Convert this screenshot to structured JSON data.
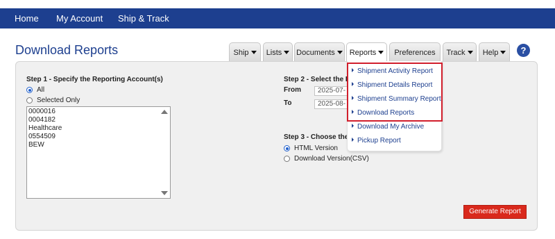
{
  "topnav": {
    "items": [
      {
        "label": "Home"
      },
      {
        "label": "My Account"
      },
      {
        "label": "Ship & Track"
      }
    ]
  },
  "page": {
    "title": "Download Reports"
  },
  "tabs": [
    {
      "label": "Ship",
      "has_caret": true
    },
    {
      "label": "Lists",
      "has_caret": true
    },
    {
      "label": "Documents",
      "has_caret": true
    },
    {
      "label": "Reports",
      "has_caret": true,
      "active": true
    },
    {
      "label": "Preferences",
      "has_caret": false
    },
    {
      "label": "Track",
      "has_caret": true
    },
    {
      "label": "Help",
      "has_caret": true
    }
  ],
  "help_icon": {
    "glyph": "?"
  },
  "step1": {
    "heading": "Step 1 - Specify the Reporting Account(s)",
    "radio_all": "All",
    "radio_selected": "Selected Only",
    "selected_option": "All",
    "accounts": [
      "0000016",
      "0004182",
      "Healthcare",
      "0554509",
      "BEW"
    ]
  },
  "step2": {
    "heading": "Step 2 - Select the D",
    "from_label": "From",
    "from_value": "2025-07-",
    "to_label": "To",
    "to_value": "2025-08-"
  },
  "step3": {
    "heading": "Step 3 - Choose the",
    "option_html": "HTML Version",
    "option_csv": "Download Version(CSV)",
    "selected_option": "HTML Version"
  },
  "reports_menu": {
    "items": [
      {
        "label": "Shipment Activity Report"
      },
      {
        "label": "Shipment Details Report"
      },
      {
        "label": "Shipment Summary Report"
      },
      {
        "label": "Download Reports"
      },
      {
        "label": "Download My Archive"
      },
      {
        "label": "Pickup Report"
      }
    ],
    "highlight_color": "#d11e2c"
  },
  "generate_button": {
    "label": "Generate Report"
  },
  "colors": {
    "brand_blue": "#1d3f8f",
    "button_red": "#d9291c",
    "panel_bg": "#f0f0f0"
  }
}
